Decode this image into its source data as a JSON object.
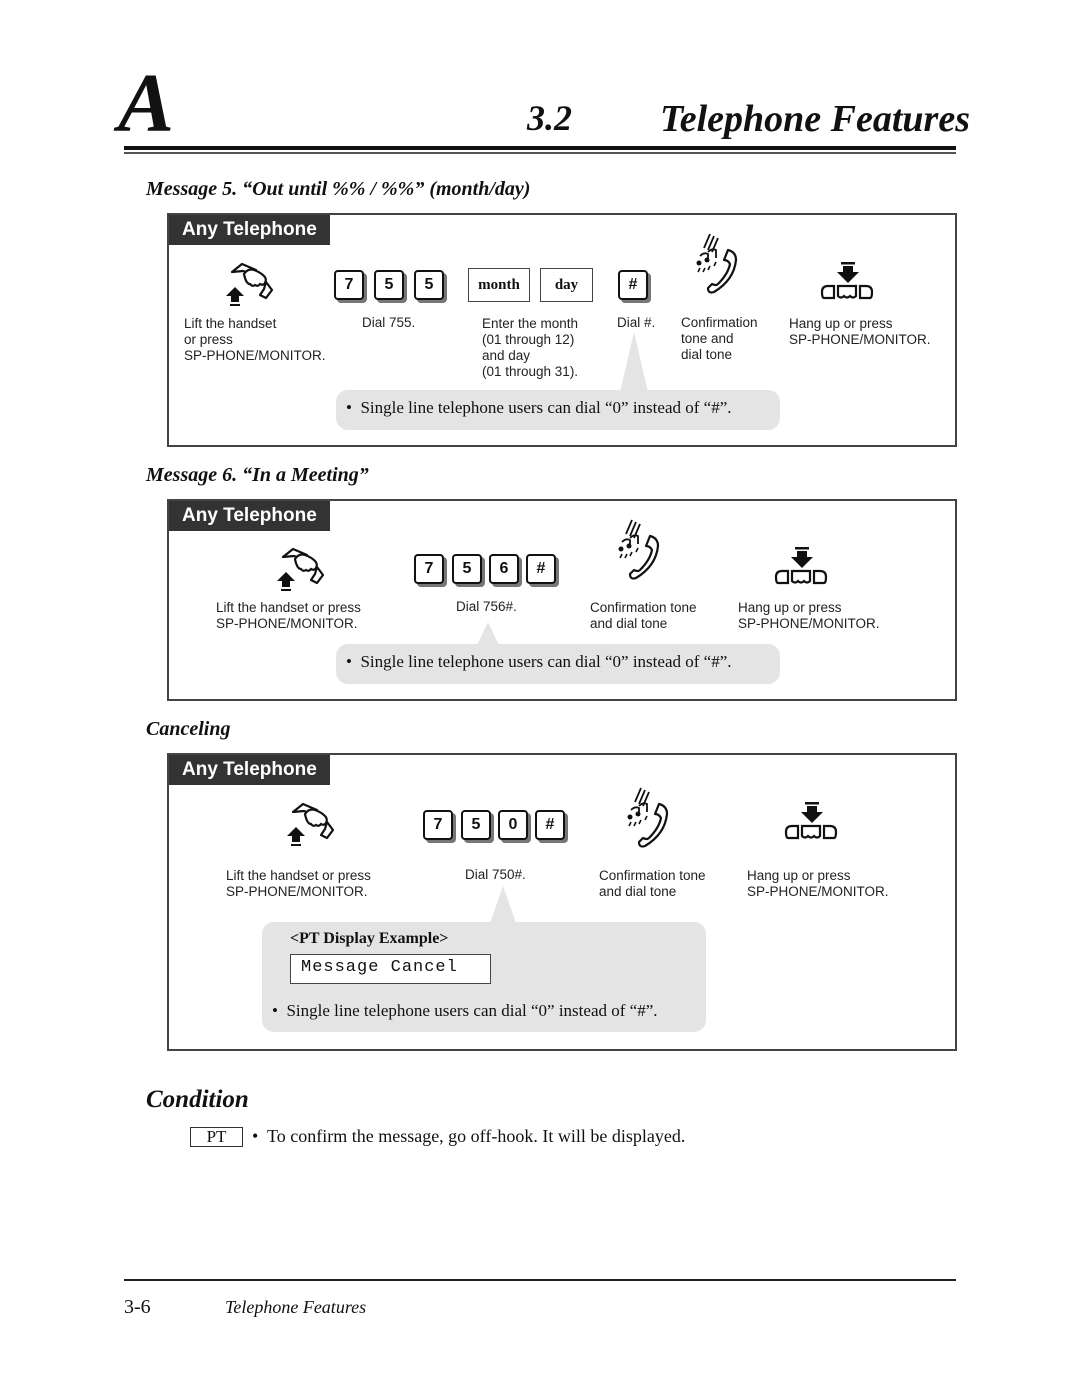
{
  "header": {
    "chapter_letter": "A",
    "section_number": "3.2",
    "section_title": "Telephone Features"
  },
  "sections": [
    {
      "heading": "Message 5. “Out until %% / %%” (month/day)",
      "badge": "Any Telephone",
      "keys": [
        "7",
        "5",
        "5"
      ],
      "word_keys": [
        "month",
        "day"
      ],
      "hash_key": "#",
      "captions": {
        "lift": "Lift the handset\nor press\nSP-PHONE/MONITOR.",
        "dial": "Dial 755.",
        "enter": "Enter the month\n(01 through 12)\nand day\n(01 through 31).",
        "dial_hash": "Dial #.",
        "confirm": "Confirmation\ntone and\ndial tone",
        "hangup": "Hang up or press\nSP-PHONE/MONITOR."
      },
      "note": "Single line telephone users can dial “0” instead of “#”."
    },
    {
      "heading": "Message 6. “In a Meeting”",
      "badge": "Any Telephone",
      "keys": [
        "7",
        "5",
        "6",
        "#"
      ],
      "captions": {
        "lift": "Lift the handset or press\nSP-PHONE/MONITOR.",
        "dial": "Dial 756#.",
        "confirm": "Confirmation tone\nand dial tone",
        "hangup": "Hang up or press\nSP-PHONE/MONITOR."
      },
      "note": "Single line telephone users can dial “0” instead of “#”."
    },
    {
      "heading": "Canceling",
      "badge": "Any Telephone",
      "keys": [
        "7",
        "5",
        "0",
        "#"
      ],
      "captions": {
        "lift": "Lift the handset or press\nSP-PHONE/MONITOR.",
        "dial": "Dial 750#.",
        "confirm": "Confirmation tone\nand dial tone",
        "hangup": "Hang up or press\nSP-PHONE/MONITOR."
      },
      "display_example_label": "<PT Display Example>",
      "display_text": "Message Cancel",
      "note": "Single line telephone users can dial “0” instead of “#”."
    }
  ],
  "condition": {
    "heading": "Condition",
    "tag": "PT",
    "text": "To confirm the message, go off-hook. It will be displayed."
  },
  "footer": {
    "page_number": "3-6",
    "title": "Telephone Features"
  },
  "bullet": "•"
}
